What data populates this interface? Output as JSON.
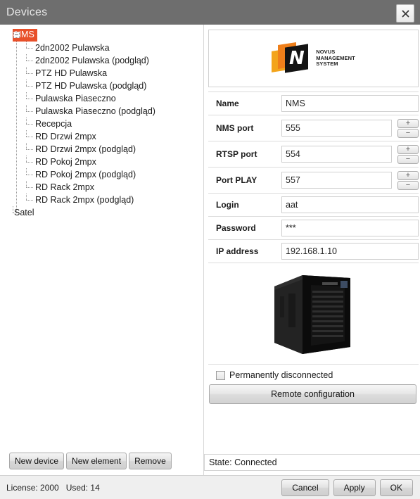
{
  "window": {
    "title": "Devices",
    "close_label": "×"
  },
  "tree": {
    "root": {
      "label": "NMS",
      "selected": true,
      "expanded": true
    },
    "children": [
      {
        "label": "2dn2002 Pulawska"
      },
      {
        "label": "2dn2002 Pulawska (podgląd)"
      },
      {
        "label": "PTZ HD Pulawska"
      },
      {
        "label": "PTZ HD Pulawska (podgląd)"
      },
      {
        "label": "Pulawska Piaseczno"
      },
      {
        "label": "Pulawska Piaseczno (podgląd)"
      },
      {
        "label": "Recepcja"
      },
      {
        "label": "RD Drzwi 2mpx"
      },
      {
        "label": "RD Drzwi 2mpx (podgląd)"
      },
      {
        "label": "RD Pokoj 2mpx"
      },
      {
        "label": "RD Pokoj 2mpx (podgląd)"
      },
      {
        "label": "RD Rack 2mpx"
      },
      {
        "label": "RD Rack 2mpx (podgląd)"
      }
    ],
    "siblings": [
      {
        "label": "Satel"
      }
    ]
  },
  "tree_buttons": {
    "new_device": "New device",
    "new_element": "New element",
    "remove": "Remove"
  },
  "logo": {
    "mark_letter": "N",
    "line1": "NOVUS",
    "line2": "MANAGEMENT",
    "line3": "SYSTEM",
    "colors": {
      "amber": "#f3a41b",
      "orange": "#ef7f1a",
      "black": "#131313"
    }
  },
  "form": {
    "name": {
      "label": "Name",
      "value": "NMS"
    },
    "nms_port": {
      "label": "NMS port",
      "value": "555",
      "inc": "+",
      "dec": "−"
    },
    "rtsp_port": {
      "label": "RTSP port",
      "value": "554",
      "inc": "+",
      "dec": "−"
    },
    "port_play": {
      "label": "Port PLAY",
      "value": "557",
      "inc": "+",
      "dec": "−"
    },
    "login": {
      "label": "Login",
      "value": "aat"
    },
    "password": {
      "label": "Password",
      "value": "***"
    },
    "ip_address": {
      "label": "IP address",
      "value": "192.168.1.10"
    }
  },
  "options": {
    "permanently_disconnected_label": "Permanently disconnected",
    "permanently_disconnected_checked": false,
    "remote_configuration": "Remote configuration"
  },
  "state": {
    "text": "State: Connected"
  },
  "statusbar": {
    "license": "License: 2000   Used: 14",
    "cancel": "Cancel",
    "apply": "Apply",
    "ok": "OK"
  },
  "colors": {
    "titlebar": "#6e6e6e",
    "selection": "#e8502a",
    "statusbar": "#efefef"
  }
}
